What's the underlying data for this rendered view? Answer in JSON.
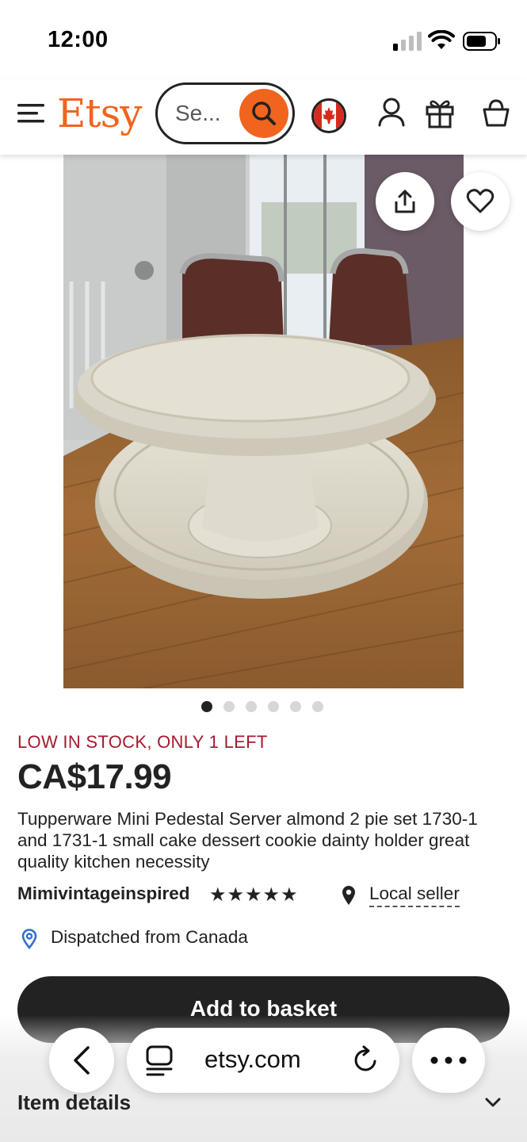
{
  "status_bar": {
    "time": "12:00"
  },
  "header": {
    "logo": "Etsy",
    "search_placeholder": "Se...",
    "icons": [
      "menu-icon",
      "search-icon",
      "canada-flag-icon",
      "account-icon",
      "gift-icon",
      "basket-icon"
    ]
  },
  "product": {
    "image_count": 6,
    "active_image": 1,
    "stock_notice": "LOW IN STOCK, ONLY 1 LEFT",
    "price": "CA$17.99",
    "title": "Tupperware Mini Pedestal Server almond 2 pie set 1730-1 and 1731-1 small cake dessert cookie dainty holder great quality kitchen necessity",
    "seller_name": "Mimivintageinspired",
    "rating": 5,
    "stars": "★★★★★",
    "local_seller_label": "Local seller",
    "dispatch_text": "Dispatched from Canada",
    "add_to_basket_label": "Add to basket",
    "item_details_label": "Item details"
  },
  "browser": {
    "url": "etsy.com"
  },
  "colors": {
    "brand": "#f1641e",
    "stock": "#a61a2e",
    "primary_button": "#222222"
  }
}
